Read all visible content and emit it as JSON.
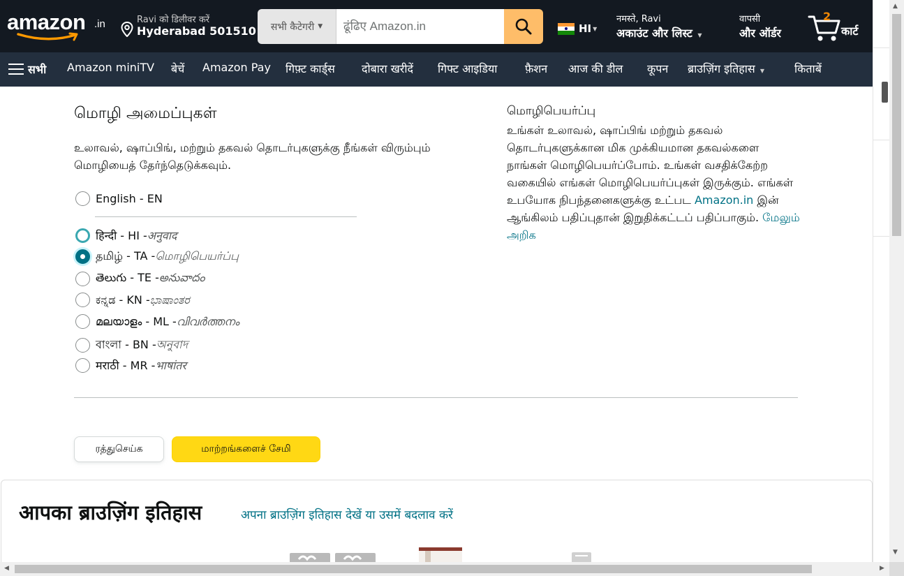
{
  "header": {
    "logo_text": "amazon",
    "logo_suffix": ".in",
    "deliver_line1": "Ravi को डिलीवर करें",
    "deliver_line2": "Hyderabad 501510",
    "search_category": "सभी कैटेगरी",
    "search_placeholder": "ढूंढिए Amazon.in",
    "language_code": "HI",
    "account_line1": "नमस्ते, Ravi",
    "account_line2": "अकाउंट और लिस्ट",
    "orders_line1": "वापसी",
    "orders_line2": "और ऑर्डर",
    "cart_count": "2",
    "cart_label": "कार्ट"
  },
  "subnav": {
    "all_label": "सभी",
    "links": [
      "Amazon miniTV",
      "बेचें",
      "Amazon Pay",
      "गिफ़्ट कार्ड्स",
      "दोबारा खरीदें",
      "गिफ्ट आइडिया",
      "फ़ैशन",
      "आज की डील",
      "कूपन",
      "ब्राउज़िंग इतिहास",
      "किताबें"
    ]
  },
  "settings": {
    "heading": "மொழி அமைப்புகள்",
    "description": "உலாவல், ஷாப்பிங், மற்றும் தகவல் தொடர்புகளுக்கு நீங்கள் விரும்பும் மொழியைத் தேர்ந்தெடுக்கவும்.",
    "options": [
      {
        "label": "English - EN",
        "translit": "",
        "state": "unchecked"
      },
      {
        "label": "हिन्दी - HI - ",
        "translit": "अनुवाद",
        "state": "focus"
      },
      {
        "label": "தமிழ் - TA - ",
        "translit": "மொழிபெயர்ப்பு",
        "state": "checked"
      },
      {
        "label": "తెలుగు - TE - ",
        "translit": "అనువాదం",
        "state": "unchecked"
      },
      {
        "label": "ಕನ್ನಡ - KN - ",
        "translit": "ಭಾಷಾಂತರ",
        "state": "unchecked"
      },
      {
        "label": "മലയാളം - ML - ",
        "translit": "വിവർത്തനം",
        "state": "unchecked"
      },
      {
        "label": "বাংলা - BN - ",
        "translit": "অনুবাদ",
        "state": "unchecked"
      },
      {
        "label": "मराठी - MR - ",
        "translit": "भाषांतर",
        "state": "unchecked"
      }
    ],
    "cancel_label": "ரத்துசெய்க",
    "save_label": "மாற்றங்களைச் சேமி"
  },
  "translation_info": {
    "title": "மொழிபெயர்ப்பு",
    "body_part1": "உங்கள் உலாவல், ஷாப்பிங் மற்றும் தகவல் தொடர்புகளுக்கான மிக முக்கியமான தகவல்களை நாங்கள் மொழிபெயர்ப்போம். உங்கள் வசதிக்கேற்ற வகையில் எங்கள் மொழிபெயர்ப்புகள் இருக்கும். எங்கள் உபயோக நிபந்தனைகளுக்கு உட்பட ",
    "body_link1": "Amazon.in",
    "body_part2": " இன் ஆங்கிலம் பதிப்புதான் இறுதிக்கட்டப் பதிப்பாகும். ",
    "body_link2": "மேலும் அறிக"
  },
  "history": {
    "title": "आपका ब्राउज़िंग इतिहास",
    "link": "अपना ब्राउज़िंग इतिहास देखें या उसमें बदलाव करें"
  },
  "colors": {
    "nav_dark": "#131921",
    "nav_secondary": "#232f3e",
    "search_button": "#febd69",
    "save_button": "#ffd814",
    "link": "#007185",
    "cart_count": "#f08804"
  }
}
